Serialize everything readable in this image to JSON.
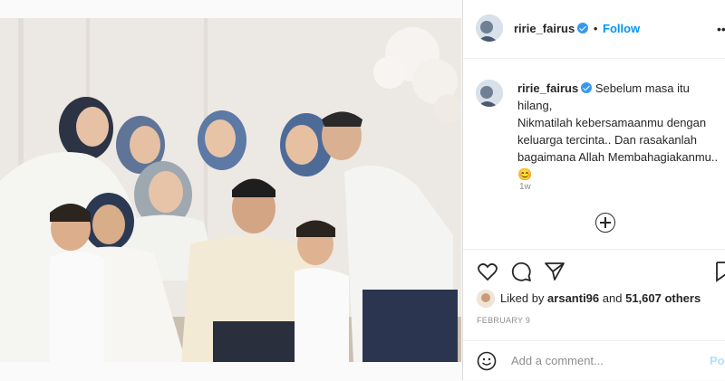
{
  "post": {
    "username": "ririe_fairus",
    "follow_label": "Follow",
    "caption": "Sebelum masa itu hilang,\nNikmatilah kebersamaanmu dengan keluarga tercinta.. Dan rasakanlah bagaimana Allah Membahagiakanmu..",
    "emoji": "😊",
    "time_ago": "1w",
    "liked_by_prefix": "Liked by",
    "liked_by_user": "arsanti96",
    "liked_by_and": "and",
    "likes_others": "51,607 others",
    "date": "FEBRUARY 9",
    "comment_placeholder": "Add a comment...",
    "post_label": "Po"
  },
  "colors": {
    "accent": "#0095f6",
    "verified": "#3897f0",
    "muted": "#8e8e8e",
    "text": "#262626"
  },
  "icons": [
    "verified-icon",
    "more-options-icon",
    "heart-icon",
    "comment-icon",
    "share-icon",
    "bookmark-icon",
    "add-icon",
    "emoji-icon"
  ]
}
